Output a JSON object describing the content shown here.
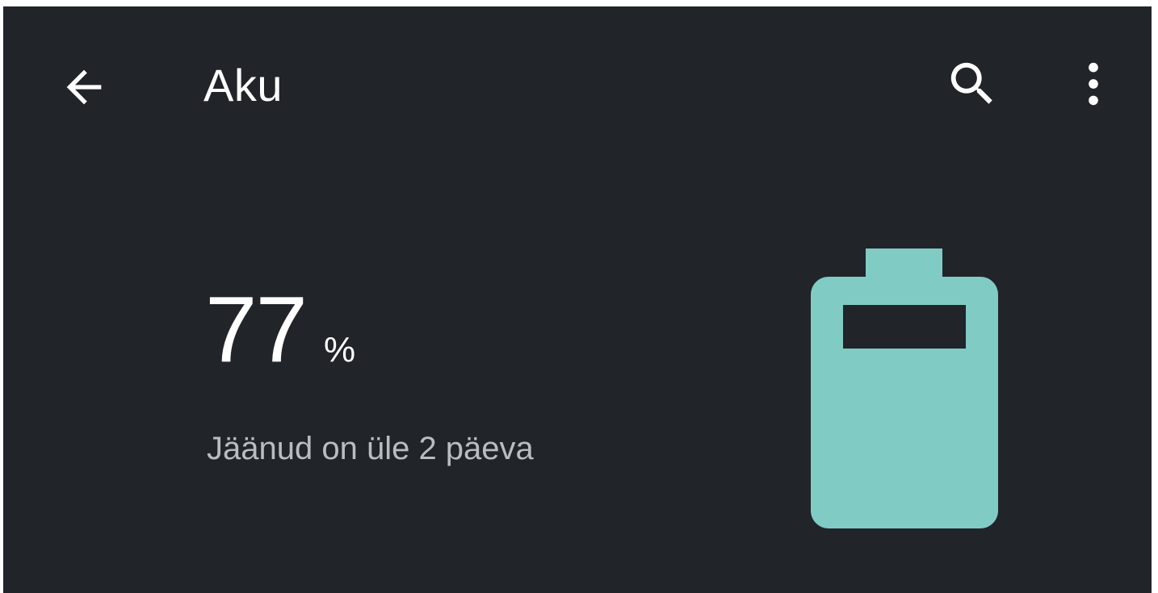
{
  "header": {
    "title": "Aku",
    "back_icon": "arrow-back-icon",
    "search_icon": "search-icon",
    "more_icon": "more-vert-icon"
  },
  "battery": {
    "level_value": "77",
    "level_unit": "%",
    "level_fraction": 0.77,
    "remaining_text": "Jäänud on üle 2 päeva",
    "icon": "battery-icon"
  },
  "colors": {
    "background": "#212429",
    "accent": "#81cbc5",
    "text_primary": "#ffffff",
    "text_secondary": "#b9bcc1"
  }
}
